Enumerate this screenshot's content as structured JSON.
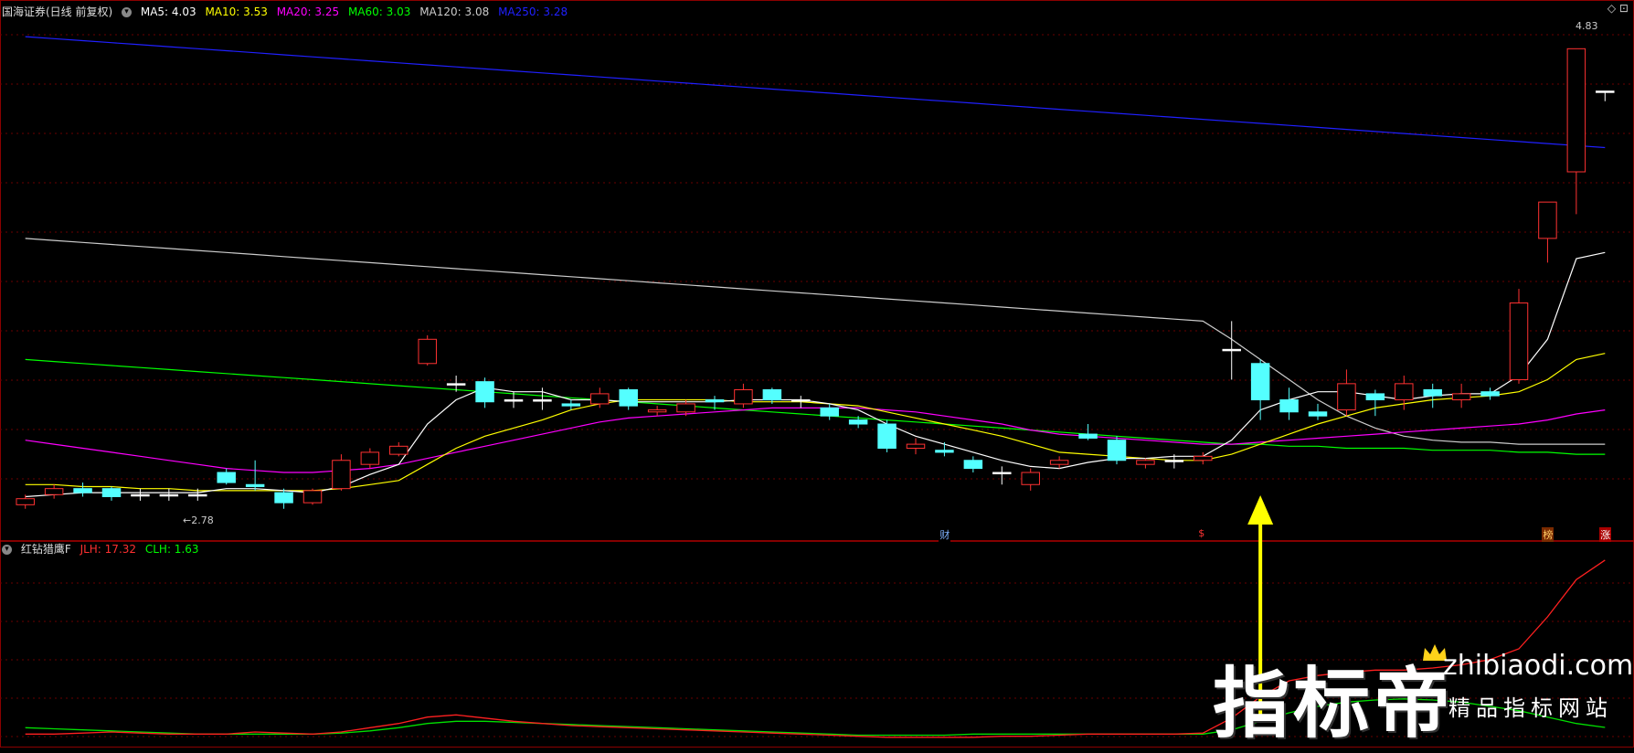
{
  "main_panel": {
    "title": "国海证券(日线 前复权)",
    "ma": [
      {
        "label": "MA5: 4.03",
        "color": "#ffffff"
      },
      {
        "label": "MA10: 3.53",
        "color": "#ffff00"
      },
      {
        "label": "MA20: 3.25",
        "color": "#ff00ff"
      },
      {
        "label": "MA60: 3.03",
        "color": "#00ff00"
      },
      {
        "label": "MA120: 3.08",
        "color": "#cccccc"
      },
      {
        "label": "MA250: 3.28",
        "color": "#2020ff"
      }
    ],
    "price_high_label": "4.83",
    "price_low_label": "2.78",
    "events": [
      {
        "label": "财",
        "color": "#7fb2ff",
        "bg": "#000"
      },
      {
        "label": "$",
        "color": "#ff3333",
        "bg": "#000"
      },
      {
        "label": "榜",
        "color": "#ffcc66",
        "bg": "#7a2a00"
      },
      {
        "label": "涨",
        "color": "#ffffff",
        "bg": "#aa0000"
      }
    ]
  },
  "indicator_panel": {
    "title": "红钻猎鹰F",
    "jlh": {
      "label": "JLH: 17.32",
      "color": "#ff3030"
    },
    "clh": {
      "label": "CLH: 1.63",
      "color": "#00ff00"
    }
  },
  "corner_icons": "◇ ⊡",
  "watermark": {
    "big": "指标帝",
    "site": "zhibiaodi.com",
    "sub": "精品指标网站"
  },
  "chart_data": {
    "type": "candlestick",
    "x": [
      1,
      2,
      3,
      4,
      5,
      6,
      7,
      8,
      9,
      10,
      11,
      12,
      13,
      14,
      15,
      16,
      17,
      18,
      19,
      20,
      21,
      22,
      23,
      24,
      25,
      26,
      27,
      28,
      29,
      30,
      31,
      32,
      33,
      34,
      35,
      36,
      37,
      38,
      39,
      40,
      41,
      42,
      43,
      44,
      45,
      46,
      47,
      48,
      49,
      50,
      51,
      52,
      53,
      54,
      55,
      56
    ],
    "ohlc": [
      [
        2.78,
        2.83,
        2.76,
        2.81
      ],
      [
        2.83,
        2.88,
        2.81,
        2.86
      ],
      [
        2.86,
        2.89,
        2.82,
        2.84
      ],
      [
        2.86,
        2.87,
        2.8,
        2.82
      ],
      [
        2.83,
        2.86,
        2.8,
        2.83
      ],
      [
        2.83,
        2.86,
        2.8,
        2.83
      ],
      [
        2.83,
        2.86,
        2.8,
        2.83
      ],
      [
        2.94,
        2.96,
        2.88,
        2.89
      ],
      [
        2.88,
        3.0,
        2.85,
        2.87
      ],
      [
        2.84,
        2.86,
        2.76,
        2.79
      ],
      [
        2.79,
        2.86,
        2.78,
        2.85
      ],
      [
        2.86,
        3.03,
        2.85,
        3.0
      ],
      [
        2.98,
        3.06,
        2.96,
        3.04
      ],
      [
        3.03,
        3.09,
        3.02,
        3.07
      ],
      [
        3.48,
        3.62,
        3.47,
        3.6
      ],
      [
        3.38,
        3.42,
        3.34,
        3.38
      ],
      [
        3.39,
        3.41,
        3.26,
        3.29
      ],
      [
        3.3,
        3.34,
        3.26,
        3.3
      ],
      [
        3.3,
        3.36,
        3.25,
        3.3
      ],
      [
        3.28,
        3.3,
        3.25,
        3.27
      ],
      [
        3.28,
        3.36,
        3.26,
        3.33
      ],
      [
        3.35,
        3.36,
        3.25,
        3.27
      ],
      [
        3.24,
        3.27,
        3.22,
        3.25
      ],
      [
        3.24,
        3.3,
        3.22,
        3.28
      ],
      [
        3.3,
        3.32,
        3.25,
        3.29
      ],
      [
        3.28,
        3.38,
        3.26,
        3.35
      ],
      [
        3.35,
        3.36,
        3.28,
        3.3
      ],
      [
        3.3,
        3.32,
        3.26,
        3.3
      ],
      [
        3.26,
        3.28,
        3.2,
        3.22
      ],
      [
        3.2,
        3.22,
        3.16,
        3.18
      ],
      [
        3.18,
        3.2,
        3.04,
        3.06
      ],
      [
        3.06,
        3.11,
        3.03,
        3.08
      ],
      [
        3.05,
        3.09,
        3.02,
        3.04
      ],
      [
        3.0,
        3.02,
        2.94,
        2.96
      ],
      [
        2.94,
        2.97,
        2.88,
        2.94
      ],
      [
        2.88,
        2.96,
        2.85,
        2.94
      ],
      [
        2.98,
        3.02,
        2.96,
        3.0
      ],
      [
        3.13,
        3.18,
        3.1,
        3.11
      ],
      [
        3.1,
        3.12,
        2.98,
        3.0
      ],
      [
        2.98,
        3.01,
        2.96,
        3.0
      ],
      [
        3.0,
        3.03,
        2.96,
        3.0
      ],
      [
        3.0,
        3.04,
        2.98,
        3.02
      ],
      [
        3.55,
        3.69,
        3.4,
        3.55
      ],
      [
        3.48,
        3.5,
        3.2,
        3.3
      ],
      [
        3.3,
        3.36,
        3.2,
        3.24
      ],
      [
        3.24,
        3.28,
        3.2,
        3.22
      ],
      [
        3.25,
        3.45,
        3.22,
        3.38
      ],
      [
        3.33,
        3.35,
        3.22,
        3.3
      ],
      [
        3.3,
        3.42,
        3.25,
        3.38
      ],
      [
        3.35,
        3.38,
        3.26,
        3.32
      ],
      [
        3.3,
        3.38,
        3.26,
        3.33
      ],
      [
        3.34,
        3.36,
        3.3,
        3.32
      ],
      [
        3.4,
        3.85,
        3.38,
        3.78
      ],
      [
        4.1,
        4.25,
        3.98,
        4.28
      ],
      [
        4.43,
        4.98,
        4.22,
        5.04
      ],
      [
        4.83,
        4.83,
        4.78,
        4.83
      ]
    ],
    "ma5": [
      2.82,
      2.83,
      2.84,
      2.84,
      2.84,
      2.84,
      2.84,
      2.86,
      2.86,
      2.85,
      2.84,
      2.87,
      2.93,
      2.98,
      3.18,
      3.3,
      3.36,
      3.34,
      3.34,
      3.3,
      3.3,
      3.29,
      3.29,
      3.29,
      3.29,
      3.3,
      3.3,
      3.3,
      3.28,
      3.25,
      3.18,
      3.12,
      3.08,
      3.04,
      3.0,
      2.97,
      2.96,
      2.99,
      3.01,
      3.01,
      3.02,
      3.02,
      3.1,
      3.25,
      3.3,
      3.34,
      3.34,
      3.32,
      3.3,
      3.32,
      3.33,
      3.33,
      3.42,
      3.6,
      4.0,
      4.03
    ],
    "ma10": [
      2.88,
      2.88,
      2.87,
      2.87,
      2.86,
      2.86,
      2.85,
      2.85,
      2.85,
      2.85,
      2.85,
      2.86,
      2.88,
      2.9,
      2.98,
      3.06,
      3.12,
      3.16,
      3.2,
      3.25,
      3.28,
      3.3,
      3.3,
      3.3,
      3.3,
      3.29,
      3.29,
      3.29,
      3.28,
      3.27,
      3.24,
      3.21,
      3.18,
      3.15,
      3.12,
      3.08,
      3.04,
      3.03,
      3.02,
      3.01,
      3.0,
      3.0,
      3.03,
      3.08,
      3.13,
      3.18,
      3.22,
      3.26,
      3.28,
      3.3,
      3.31,
      3.32,
      3.34,
      3.4,
      3.5,
      3.53
    ],
    "ma20": [
      3.1,
      3.08,
      3.06,
      3.04,
      3.02,
      3.0,
      2.98,
      2.96,
      2.95,
      2.94,
      2.94,
      2.95,
      2.96,
      2.98,
      3.01,
      3.04,
      3.07,
      3.1,
      3.13,
      3.16,
      3.19,
      3.21,
      3.22,
      3.23,
      3.24,
      3.25,
      3.26,
      3.26,
      3.26,
      3.26,
      3.25,
      3.24,
      3.22,
      3.2,
      3.18,
      3.15,
      3.13,
      3.12,
      3.11,
      3.1,
      3.09,
      3.08,
      3.08,
      3.09,
      3.1,
      3.11,
      3.12,
      3.13,
      3.14,
      3.15,
      3.16,
      3.17,
      3.18,
      3.2,
      3.23,
      3.25
    ],
    "ma60": [
      3.5,
      3.49,
      3.48,
      3.47,
      3.46,
      3.45,
      3.44,
      3.43,
      3.42,
      3.41,
      3.4,
      3.39,
      3.38,
      3.37,
      3.36,
      3.35,
      3.34,
      3.33,
      3.32,
      3.31,
      3.3,
      3.29,
      3.28,
      3.27,
      3.26,
      3.25,
      3.24,
      3.23,
      3.22,
      3.21,
      3.2,
      3.19,
      3.18,
      3.17,
      3.16,
      3.15,
      3.14,
      3.13,
      3.12,
      3.11,
      3.1,
      3.09,
      3.08,
      3.08,
      3.07,
      3.07,
      3.06,
      3.06,
      3.06,
      3.05,
      3.05,
      3.05,
      3.04,
      3.04,
      3.03,
      3.03
    ],
    "ma120": [
      4.1,
      4.09,
      4.08,
      4.07,
      4.06,
      4.05,
      4.04,
      4.03,
      4.02,
      4.01,
      4.0,
      3.99,
      3.98,
      3.97,
      3.96,
      3.95,
      3.94,
      3.93,
      3.92,
      3.91,
      3.9,
      3.89,
      3.88,
      3.87,
      3.86,
      3.85,
      3.84,
      3.83,
      3.82,
      3.81,
      3.8,
      3.79,
      3.78,
      3.77,
      3.76,
      3.75,
      3.74,
      3.73,
      3.72,
      3.71,
      3.7,
      3.69,
      3.6,
      3.5,
      3.4,
      3.3,
      3.22,
      3.16,
      3.12,
      3.1,
      3.09,
      3.09,
      3.08,
      3.08,
      3.08,
      3.08
    ],
    "ma250": [
      5.1,
      5.09,
      5.08,
      5.07,
      5.06,
      5.05,
      5.04,
      5.03,
      5.02,
      5.01,
      5.0,
      4.99,
      4.98,
      4.97,
      4.96,
      4.95,
      4.94,
      4.93,
      4.92,
      4.91,
      4.9,
      4.89,
      4.88,
      4.87,
      4.86,
      4.85,
      4.84,
      4.83,
      4.82,
      4.81,
      4.8,
      4.79,
      4.78,
      4.77,
      4.76,
      4.75,
      4.74,
      4.73,
      4.72,
      4.71,
      4.7,
      4.69,
      4.68,
      4.67,
      4.66,
      4.65,
      4.64,
      4.63,
      4.62,
      4.61,
      4.6,
      4.59,
      4.58,
      4.57,
      4.56,
      4.55
    ],
    "jlh": [
      1.0,
      1.0,
      1.1,
      1.2,
      1.1,
      1.0,
      1.0,
      1.0,
      1.2,
      1.1,
      1.0,
      1.2,
      1.6,
      2.0,
      2.6,
      2.8,
      2.5,
      2.2,
      2.0,
      1.8,
      1.7,
      1.6,
      1.5,
      1.4,
      1.3,
      1.2,
      1.1,
      1.0,
      0.9,
      0.8,
      0.7,
      0.7,
      0.7,
      0.7,
      0.8,
      0.8,
      0.9,
      1.0,
      1.0,
      1.0,
      1.0,
      1.1,
      2.5,
      4.5,
      6.0,
      6.5,
      6.8,
      7.0,
      7.0,
      7.2,
      7.5,
      8.0,
      9.0,
      12.0,
      15.5,
      17.32
    ],
    "clh": [
      1.6,
      1.5,
      1.4,
      1.3,
      1.2,
      1.1,
      1.0,
      1.0,
      1.0,
      1.0,
      1.0,
      1.1,
      1.3,
      1.6,
      2.0,
      2.2,
      2.2,
      2.1,
      2.0,
      1.9,
      1.8,
      1.7,
      1.6,
      1.5,
      1.4,
      1.3,
      1.2,
      1.1,
      1.0,
      0.9,
      0.9,
      0.9,
      0.9,
      1.0,
      1.0,
      1.0,
      1.0,
      1.0,
      1.0,
      1.0,
      1.0,
      1.0,
      1.4,
      2.2,
      3.0,
      3.6,
      4.0,
      4.2,
      4.3,
      4.2,
      4.0,
      3.6,
      3.2,
      2.6,
      2.0,
      1.63
    ],
    "events_at": [
      33,
      42,
      54,
      56
    ]
  }
}
